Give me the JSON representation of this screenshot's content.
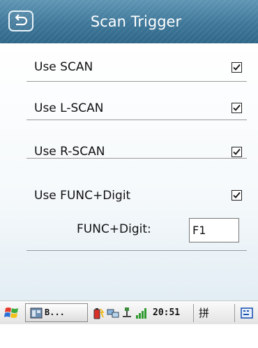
{
  "title_bar": {
    "title": "Scan Trigger",
    "back_icon": "back-arrow-icon",
    "colors": {
      "background": "#3f7799",
      "text": "#ffffff"
    }
  },
  "settings": {
    "use_scan": {
      "label": "Use SCAN",
      "checked": true
    },
    "use_lscan": {
      "label": "Use L-SCAN",
      "checked": true
    },
    "use_rscan": {
      "label": "Use R-SCAN",
      "checked": true
    },
    "use_func_digit": {
      "label": "Use FUNC+Digit",
      "checked": true,
      "field_label": "FUNC+Digit:",
      "field_value": "F1"
    }
  },
  "taskbar": {
    "start_icon": "windows-start-icon",
    "task_button_label": "B...",
    "tray_icons": [
      "battery-icon",
      "network-icon",
      "usb-icon",
      "signal-icon"
    ],
    "clock": "20:51",
    "ime_label": "拼",
    "keyboard_icon": "keyboard-icon"
  }
}
